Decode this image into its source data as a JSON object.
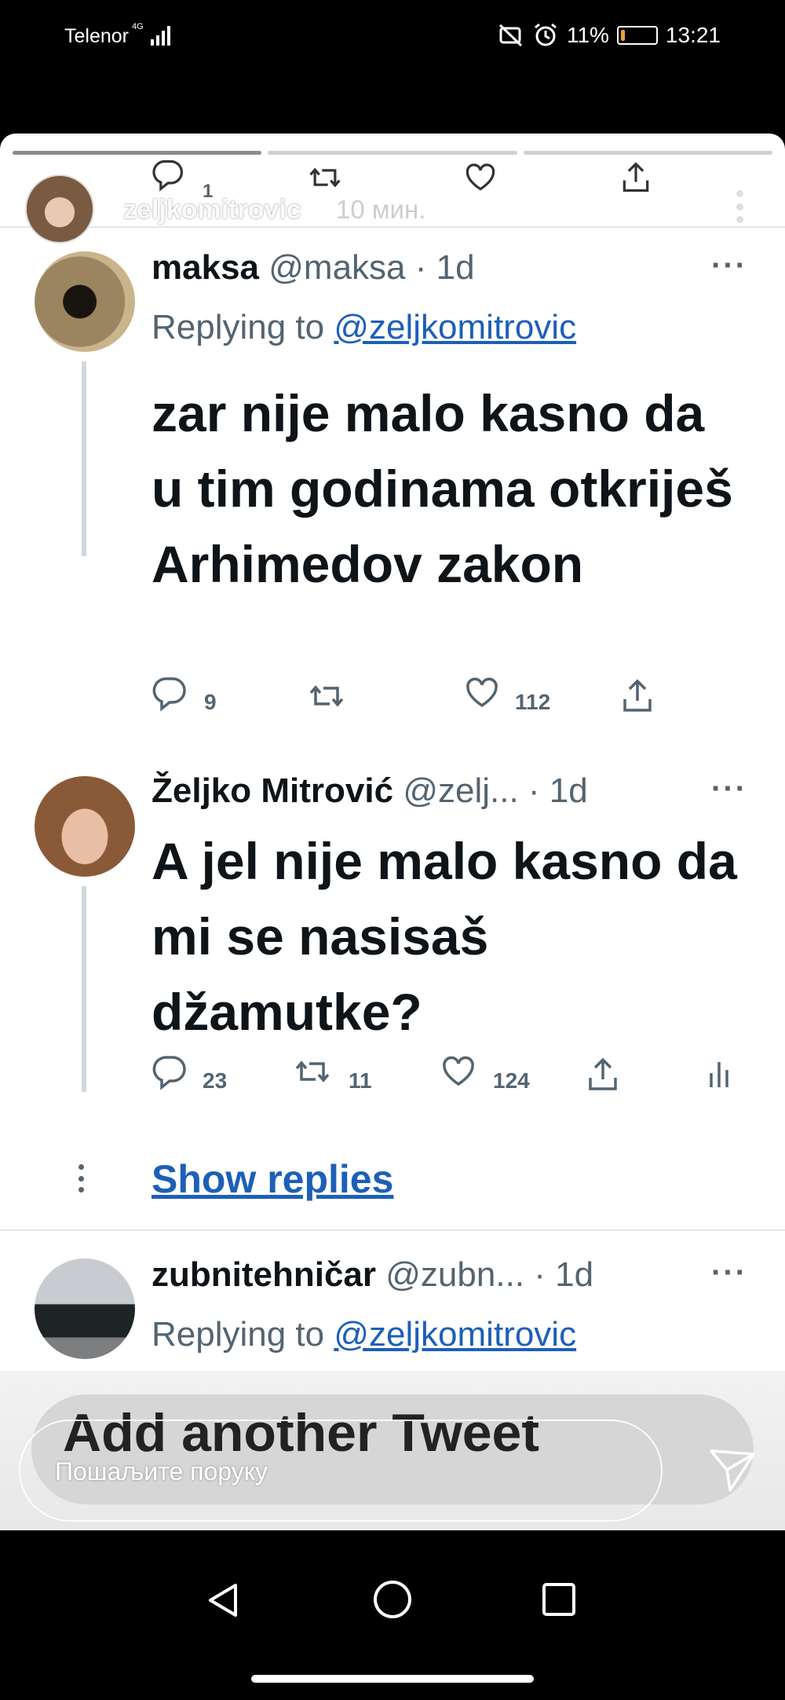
{
  "status_bar": {
    "carrier": "Telenor",
    "network": "4G",
    "battery_percent": "11%",
    "battery_level": 0.11,
    "time": "13:21"
  },
  "story": {
    "username": "zeljkomitrovic",
    "time_ago": "10 мин.",
    "progress_segments": 3,
    "active_segment": 0
  },
  "previous_tweet_actions": {
    "reply_count": "1"
  },
  "tweets": [
    {
      "name": "maksa",
      "handle": "@maksa",
      "time": "· 1d",
      "more": "···",
      "replying_prefix": "Replying to ",
      "replying_to": "@zeljkomitrovic",
      "text": "zar nije malo kasno da u tim godinama otkriješ Arhimedov zakon",
      "replies": "9",
      "retweets": "",
      "likes": "112"
    },
    {
      "name": "Željko Mitrović",
      "handle": "@zelj...",
      "time": "· 1d",
      "more": "···",
      "text": "A jel nije malo kasno da mi se nasisaš džamutke?",
      "replies": "23",
      "retweets": "11",
      "likes": "124"
    },
    {
      "name": "zubnitehničar",
      "handle": "@zubn...",
      "time": "· 1d",
      "more": "···",
      "replying_prefix": "Replying to ",
      "replying_to": "@zeljkomitrovic"
    }
  ],
  "show_replies": "Show replies",
  "add_another_tweet": "Add another Tweet",
  "message_input": {
    "placeholder": "Пошаљите поруку"
  },
  "icons": {
    "reply": "comment-icon",
    "retweet": "retweet-icon",
    "like": "heart-icon",
    "share": "share-icon",
    "analytics": "analytics-icon",
    "send": "send-icon"
  },
  "colors": {
    "link": "#1d5fb8",
    "secondary_text": "#536471",
    "primary_text": "#0f1419"
  }
}
